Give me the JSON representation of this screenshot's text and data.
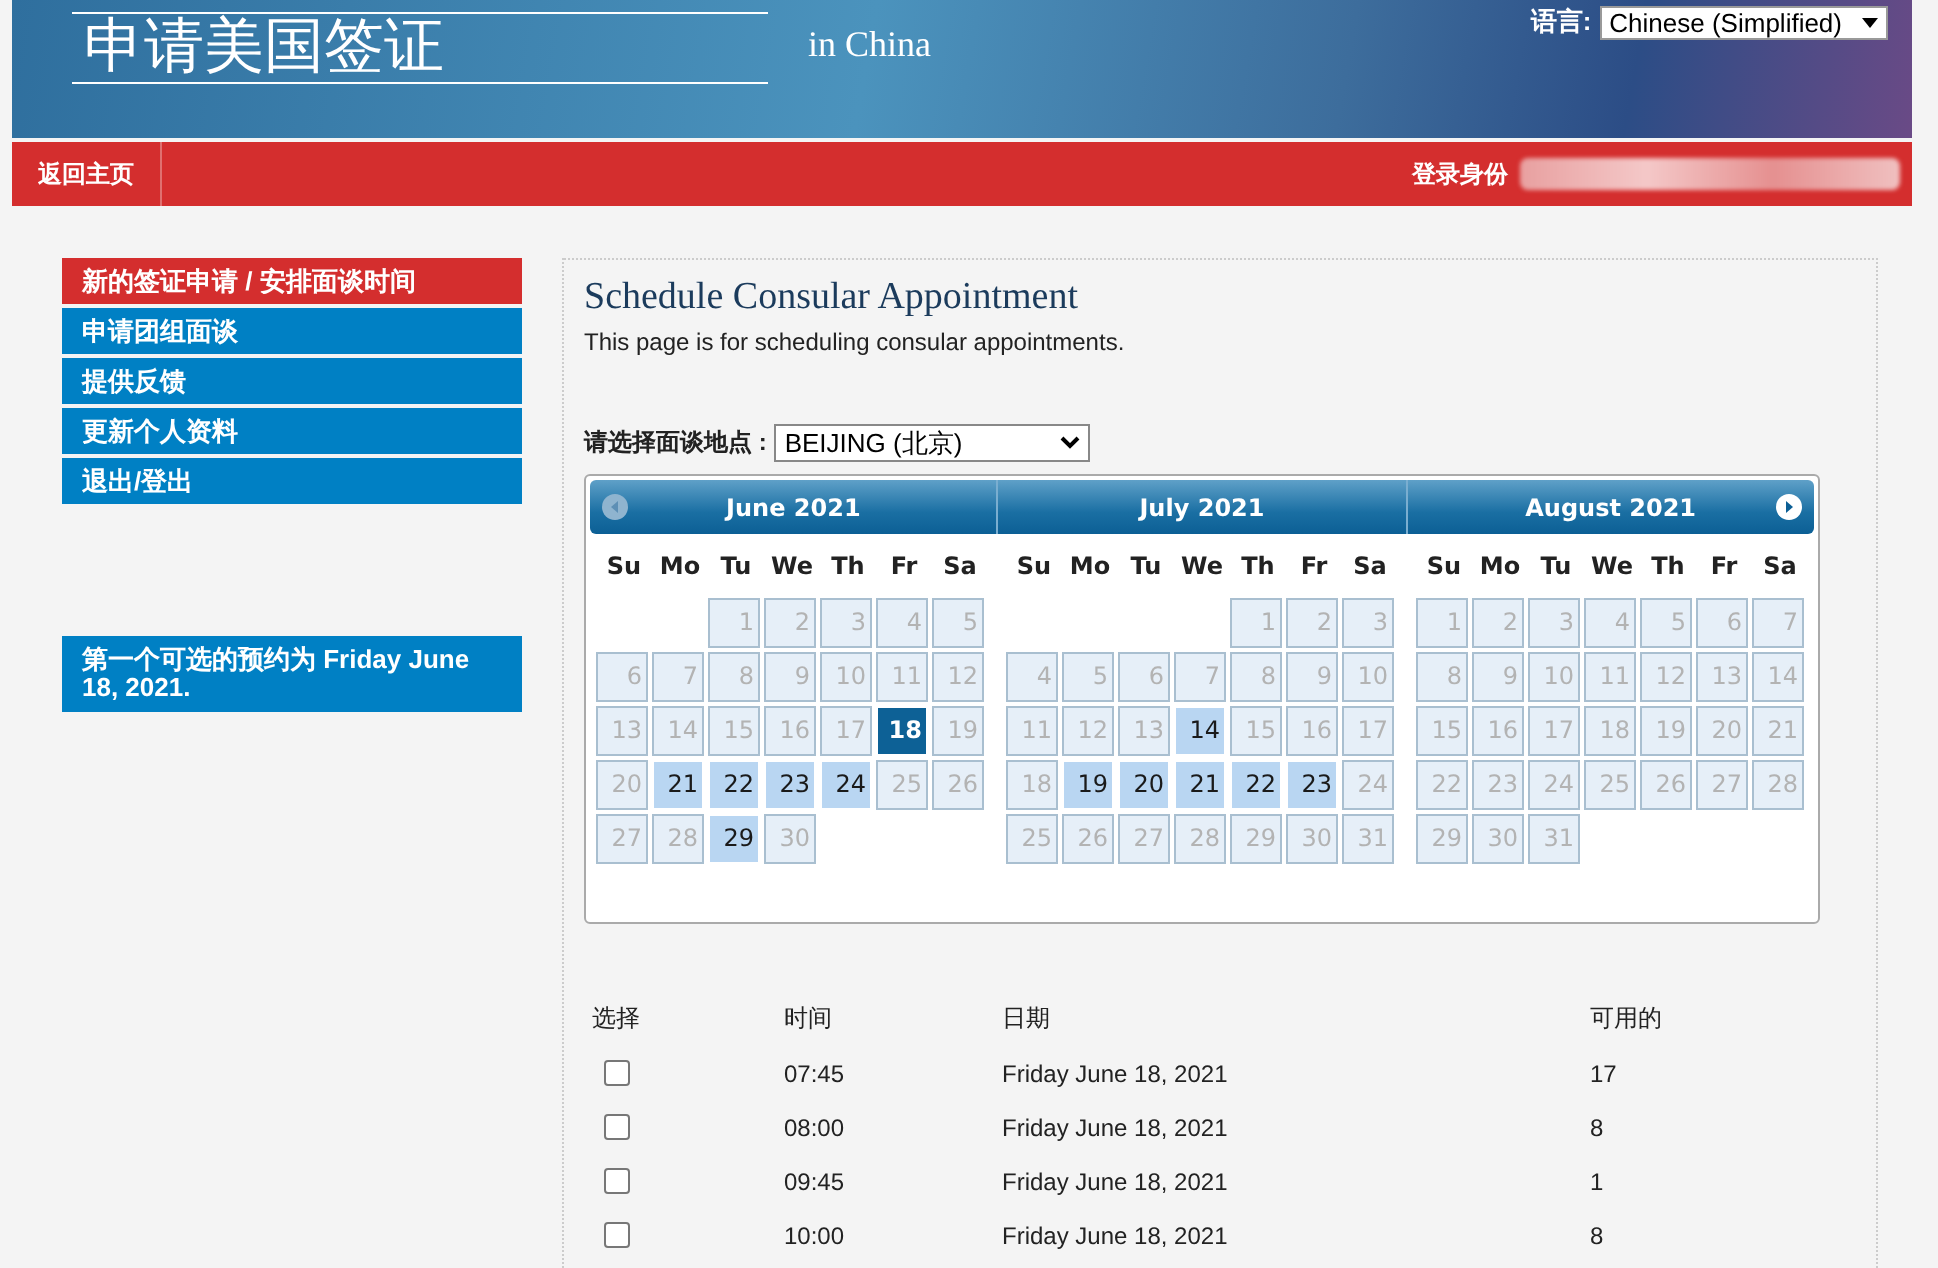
{
  "header": {
    "title": "申请美国签证",
    "subtitle": "in China",
    "language_label": "语言:",
    "language": "Chinese (Simplified)"
  },
  "nav": {
    "home": "返回主页",
    "login_label": "登录身份"
  },
  "sidebar": {
    "items": [
      {
        "label": "新的签证申请 / 安排面谈时间",
        "selected": true
      },
      {
        "label": "申请团组面谈",
        "selected": false
      },
      {
        "label": "提供反馈",
        "selected": false
      },
      {
        "label": "更新个人资料",
        "selected": false
      },
      {
        "label": "退出/登出",
        "selected": false
      }
    ],
    "notice": "第一个可选的预约为 Friday June 18, 2021."
  },
  "main": {
    "title": "Schedule Consular Appointment",
    "description": "This page is for scheduling consular appointments.",
    "location_label": "请选择面谈地点 :",
    "location": "BEIJING (北京)"
  },
  "calendar": {
    "months": [
      {
        "title": "June 2021",
        "weekdays": [
          "Su",
          "Mo",
          "Tu",
          "We",
          "Th",
          "Fr",
          "Sa"
        ],
        "weeks": [
          [
            {
              "day": "1",
              "available": false,
              "selected": false
            },
            {
              "day": "2",
              "available": false,
              "selected": false
            },
            {
              "day": "3",
              "available": false,
              "selected": false
            },
            {
              "day": "4",
              "available": false,
              "selected": false
            },
            {
              "day": "5",
              "available": false,
              "selected": false
            }
          ],
          [
            {
              "day": "6",
              "available": false,
              "selected": false
            },
            {
              "day": "7",
              "available": false,
              "selected": false
            },
            {
              "day": "8",
              "available": false,
              "selected": false
            },
            {
              "day": "9",
              "available": false,
              "selected": false
            },
            {
              "day": "10",
              "available": false,
              "selected": false
            },
            {
              "day": "11",
              "available": false,
              "selected": false
            },
            {
              "day": "12",
              "available": false,
              "selected": false
            }
          ],
          [
            {
              "day": "13",
              "available": false,
              "selected": false
            },
            {
              "day": "14",
              "available": false,
              "selected": false
            },
            {
              "day": "15",
              "available": false,
              "selected": false
            },
            {
              "day": "16",
              "available": false,
              "selected": false
            },
            {
              "day": "17",
              "available": false,
              "selected": false
            },
            {
              "day": "18",
              "available": true,
              "selected": true
            },
            {
              "day": "19",
              "available": false,
              "selected": false
            }
          ],
          [
            {
              "day": "20",
              "available": false,
              "selected": false
            },
            {
              "day": "21",
              "available": true,
              "selected": false
            },
            {
              "day": "22",
              "available": true,
              "selected": false
            },
            {
              "day": "23",
              "available": true,
              "selected": false
            },
            {
              "day": "24",
              "available": true,
              "selected": false
            },
            {
              "day": "25",
              "available": false,
              "selected": false
            },
            {
              "day": "26",
              "available": false,
              "selected": false
            }
          ],
          [
            {
              "day": "27",
              "available": false,
              "selected": false
            },
            {
              "day": "28",
              "available": false,
              "selected": false
            },
            {
              "day": "29",
              "available": true,
              "selected": false
            },
            {
              "day": "30",
              "available": false,
              "selected": false
            }
          ]
        ]
      },
      {
        "title": "July 2021",
        "weekdays": [
          "Su",
          "Mo",
          "Tu",
          "We",
          "Th",
          "Fr",
          "Sa"
        ],
        "weeks": [
          [
            {
              "day": "1",
              "available": false,
              "selected": false
            },
            {
              "day": "2",
              "available": false,
              "selected": false
            },
            {
              "day": "3",
              "available": false,
              "selected": false
            }
          ],
          [
            {
              "day": "4",
              "available": false,
              "selected": false
            },
            {
              "day": "5",
              "available": false,
              "selected": false
            },
            {
              "day": "6",
              "available": false,
              "selected": false
            },
            {
              "day": "7",
              "available": false,
              "selected": false
            },
            {
              "day": "8",
              "available": false,
              "selected": false
            },
            {
              "day": "9",
              "available": false,
              "selected": false
            },
            {
              "day": "10",
              "available": false,
              "selected": false
            }
          ],
          [
            {
              "day": "11",
              "available": false,
              "selected": false
            },
            {
              "day": "12",
              "available": false,
              "selected": false
            },
            {
              "day": "13",
              "available": false,
              "selected": false
            },
            {
              "day": "14",
              "available": true,
              "selected": false
            },
            {
              "day": "15",
              "available": false,
              "selected": false
            },
            {
              "day": "16",
              "available": false,
              "selected": false
            },
            {
              "day": "17",
              "available": false,
              "selected": false
            }
          ],
          [
            {
              "day": "18",
              "available": false,
              "selected": false
            },
            {
              "day": "19",
              "available": true,
              "selected": false
            },
            {
              "day": "20",
              "available": true,
              "selected": false
            },
            {
              "day": "21",
              "available": true,
              "selected": false
            },
            {
              "day": "22",
              "available": true,
              "selected": false
            },
            {
              "day": "23",
              "available": true,
              "selected": false
            },
            {
              "day": "24",
              "available": false,
              "selected": false
            }
          ],
          [
            {
              "day": "25",
              "available": false,
              "selected": false
            },
            {
              "day": "26",
              "available": false,
              "selected": false
            },
            {
              "day": "27",
              "available": false,
              "selected": false
            },
            {
              "day": "28",
              "available": false,
              "selected": false
            },
            {
              "day": "29",
              "available": false,
              "selected": false
            },
            {
              "day": "30",
              "available": false,
              "selected": false
            },
            {
              "day": "31",
              "available": false,
              "selected": false
            }
          ]
        ]
      },
      {
        "title": "August 2021",
        "weekdays": [
          "Su",
          "Mo",
          "Tu",
          "We",
          "Th",
          "Fr",
          "Sa"
        ],
        "weeks": [
          [
            {
              "day": "1",
              "available": false,
              "selected": false
            },
            {
              "day": "2",
              "available": false,
              "selected": false
            },
            {
              "day": "3",
              "available": false,
              "selected": false
            },
            {
              "day": "4",
              "available": false,
              "selected": false
            },
            {
              "day": "5",
              "available": false,
              "selected": false
            },
            {
              "day": "6",
              "available": false,
              "selected": false
            },
            {
              "day": "7",
              "available": false,
              "selected": false
            }
          ],
          [
            {
              "day": "8",
              "available": false,
              "selected": false
            },
            {
              "day": "9",
              "available": false,
              "selected": false
            },
            {
              "day": "10",
              "available": false,
              "selected": false
            },
            {
              "day": "11",
              "available": false,
              "selected": false
            },
            {
              "day": "12",
              "available": false,
              "selected": false
            },
            {
              "day": "13",
              "available": false,
              "selected": false
            },
            {
              "day": "14",
              "available": false,
              "selected": false
            }
          ],
          [
            {
              "day": "15",
              "available": false,
              "selected": false
            },
            {
              "day": "16",
              "available": false,
              "selected": false
            },
            {
              "day": "17",
              "available": false,
              "selected": false
            },
            {
              "day": "18",
              "available": false,
              "selected": false
            },
            {
              "day": "19",
              "available": false,
              "selected": false
            },
            {
              "day": "20",
              "available": false,
              "selected": false
            },
            {
              "day": "21",
              "available": false,
              "selected": false
            }
          ],
          [
            {
              "day": "22",
              "available": false,
              "selected": false
            },
            {
              "day": "23",
              "available": false,
              "selected": false
            },
            {
              "day": "24",
              "available": false,
              "selected": false
            },
            {
              "day": "25",
              "available": false,
              "selected": false
            },
            {
              "day": "26",
              "available": false,
              "selected": false
            },
            {
              "day": "27",
              "available": false,
              "selected": false
            },
            {
              "day": "28",
              "available": false,
              "selected": false
            }
          ],
          [
            {
              "day": "29",
              "available": false,
              "selected": false
            },
            {
              "day": "30",
              "available": false,
              "selected": false
            },
            {
              "day": "31",
              "available": false,
              "selected": false
            }
          ]
        ]
      }
    ]
  },
  "table": {
    "columns": [
      "选择",
      "时间",
      "日期",
      "可用的"
    ],
    "rows": [
      {
        "checked": false,
        "time": "07:45",
        "date": "Friday June 18, 2021",
        "available": "17"
      },
      {
        "checked": false,
        "time": "08:00",
        "date": "Friday June 18, 2021",
        "available": "8"
      },
      {
        "checked": false,
        "time": "09:45",
        "date": "Friday June 18, 2021",
        "available": "1"
      },
      {
        "checked": false,
        "time": "10:00",
        "date": "Friday June 18, 2021",
        "available": "8"
      }
    ]
  }
}
